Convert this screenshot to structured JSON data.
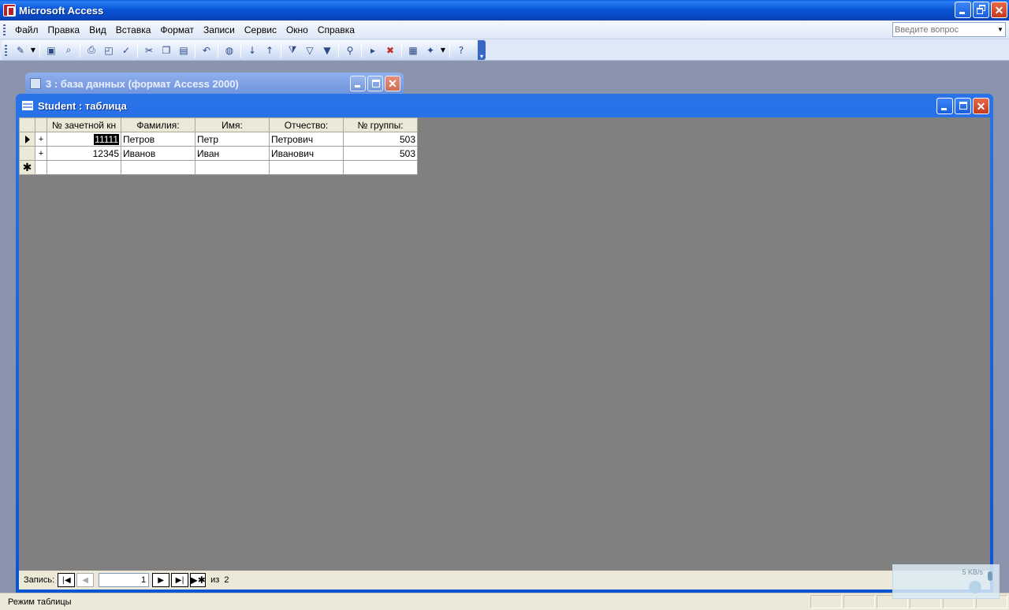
{
  "app": {
    "title": "Microsoft Access"
  },
  "menu": {
    "items": [
      "Файл",
      "Правка",
      "Вид",
      "Вставка",
      "Формат",
      "Записи",
      "Сервис",
      "Окно",
      "Справка"
    ],
    "help_placeholder": "Введите вопрос"
  },
  "toolbar": {
    "buttons": [
      "view",
      "save",
      "file-search",
      "print",
      "print-preview",
      "spelling",
      "cut",
      "copy",
      "paste",
      "undo",
      "hyperlink",
      "sort-ascending",
      "sort-descending",
      "filter-by-selection",
      "filter-by-form",
      "apply-filter",
      "find",
      "new-record",
      "delete-record",
      "database-window",
      "new-object",
      "help"
    ]
  },
  "db_window": {
    "title": "3 : база данных (формат Access 2000)"
  },
  "table_window": {
    "title": "Student : таблица",
    "columns": [
      "№ зачетной кн",
      "Фамилия:",
      "Имя:",
      "Отчество:",
      "№ группы:"
    ],
    "rows": [
      {
        "zach": "11111",
        "fam": "Петров",
        "name": "Петр",
        "otch": "Петрович",
        "grp": "503"
      },
      {
        "zach": "12345",
        "fam": "Иванов",
        "name": "Иван",
        "otch": "Иванович",
        "grp": "503"
      }
    ]
  },
  "navigator": {
    "label": "Запись:",
    "current": "1",
    "of_label": "из",
    "total": "2"
  },
  "status": {
    "text": "Режим таблицы"
  },
  "netmeter": {
    "speed": "5 KB/s"
  }
}
